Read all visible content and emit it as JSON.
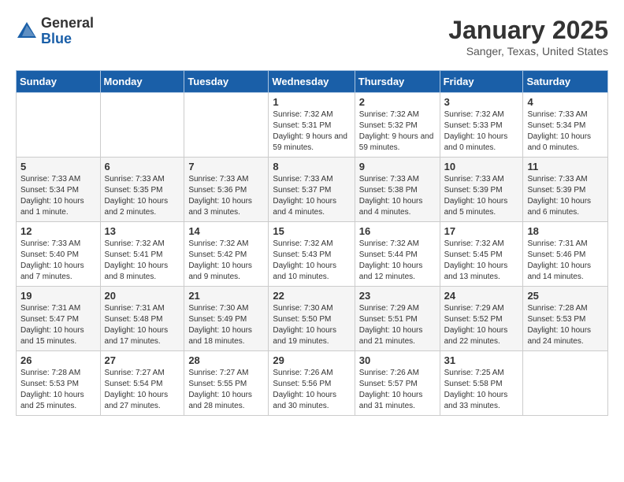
{
  "header": {
    "logo_general": "General",
    "logo_blue": "Blue",
    "title": "January 2025",
    "subtitle": "Sanger, Texas, United States"
  },
  "days_of_week": [
    "Sunday",
    "Monday",
    "Tuesday",
    "Wednesday",
    "Thursday",
    "Friday",
    "Saturday"
  ],
  "weeks": [
    [
      {
        "day": "",
        "info": ""
      },
      {
        "day": "",
        "info": ""
      },
      {
        "day": "",
        "info": ""
      },
      {
        "day": "1",
        "info": "Sunrise: 7:32 AM\nSunset: 5:31 PM\nDaylight: 9 hours and 59 minutes."
      },
      {
        "day": "2",
        "info": "Sunrise: 7:32 AM\nSunset: 5:32 PM\nDaylight: 9 hours and 59 minutes."
      },
      {
        "day": "3",
        "info": "Sunrise: 7:32 AM\nSunset: 5:33 PM\nDaylight: 10 hours and 0 minutes."
      },
      {
        "day": "4",
        "info": "Sunrise: 7:33 AM\nSunset: 5:34 PM\nDaylight: 10 hours and 0 minutes."
      }
    ],
    [
      {
        "day": "5",
        "info": "Sunrise: 7:33 AM\nSunset: 5:34 PM\nDaylight: 10 hours and 1 minute."
      },
      {
        "day": "6",
        "info": "Sunrise: 7:33 AM\nSunset: 5:35 PM\nDaylight: 10 hours and 2 minutes."
      },
      {
        "day": "7",
        "info": "Sunrise: 7:33 AM\nSunset: 5:36 PM\nDaylight: 10 hours and 3 minutes."
      },
      {
        "day": "8",
        "info": "Sunrise: 7:33 AM\nSunset: 5:37 PM\nDaylight: 10 hours and 4 minutes."
      },
      {
        "day": "9",
        "info": "Sunrise: 7:33 AM\nSunset: 5:38 PM\nDaylight: 10 hours and 4 minutes."
      },
      {
        "day": "10",
        "info": "Sunrise: 7:33 AM\nSunset: 5:39 PM\nDaylight: 10 hours and 5 minutes."
      },
      {
        "day": "11",
        "info": "Sunrise: 7:33 AM\nSunset: 5:39 PM\nDaylight: 10 hours and 6 minutes."
      }
    ],
    [
      {
        "day": "12",
        "info": "Sunrise: 7:33 AM\nSunset: 5:40 PM\nDaylight: 10 hours and 7 minutes."
      },
      {
        "day": "13",
        "info": "Sunrise: 7:32 AM\nSunset: 5:41 PM\nDaylight: 10 hours and 8 minutes."
      },
      {
        "day": "14",
        "info": "Sunrise: 7:32 AM\nSunset: 5:42 PM\nDaylight: 10 hours and 9 minutes."
      },
      {
        "day": "15",
        "info": "Sunrise: 7:32 AM\nSunset: 5:43 PM\nDaylight: 10 hours and 10 minutes."
      },
      {
        "day": "16",
        "info": "Sunrise: 7:32 AM\nSunset: 5:44 PM\nDaylight: 10 hours and 12 minutes."
      },
      {
        "day": "17",
        "info": "Sunrise: 7:32 AM\nSunset: 5:45 PM\nDaylight: 10 hours and 13 minutes."
      },
      {
        "day": "18",
        "info": "Sunrise: 7:31 AM\nSunset: 5:46 PM\nDaylight: 10 hours and 14 minutes."
      }
    ],
    [
      {
        "day": "19",
        "info": "Sunrise: 7:31 AM\nSunset: 5:47 PM\nDaylight: 10 hours and 15 minutes."
      },
      {
        "day": "20",
        "info": "Sunrise: 7:31 AM\nSunset: 5:48 PM\nDaylight: 10 hours and 17 minutes."
      },
      {
        "day": "21",
        "info": "Sunrise: 7:30 AM\nSunset: 5:49 PM\nDaylight: 10 hours and 18 minutes."
      },
      {
        "day": "22",
        "info": "Sunrise: 7:30 AM\nSunset: 5:50 PM\nDaylight: 10 hours and 19 minutes."
      },
      {
        "day": "23",
        "info": "Sunrise: 7:29 AM\nSunset: 5:51 PM\nDaylight: 10 hours and 21 minutes."
      },
      {
        "day": "24",
        "info": "Sunrise: 7:29 AM\nSunset: 5:52 PM\nDaylight: 10 hours and 22 minutes."
      },
      {
        "day": "25",
        "info": "Sunrise: 7:28 AM\nSunset: 5:53 PM\nDaylight: 10 hours and 24 minutes."
      }
    ],
    [
      {
        "day": "26",
        "info": "Sunrise: 7:28 AM\nSunset: 5:53 PM\nDaylight: 10 hours and 25 minutes."
      },
      {
        "day": "27",
        "info": "Sunrise: 7:27 AM\nSunset: 5:54 PM\nDaylight: 10 hours and 27 minutes."
      },
      {
        "day": "28",
        "info": "Sunrise: 7:27 AM\nSunset: 5:55 PM\nDaylight: 10 hours and 28 minutes."
      },
      {
        "day": "29",
        "info": "Sunrise: 7:26 AM\nSunset: 5:56 PM\nDaylight: 10 hours and 30 minutes."
      },
      {
        "day": "30",
        "info": "Sunrise: 7:26 AM\nSunset: 5:57 PM\nDaylight: 10 hours and 31 minutes."
      },
      {
        "day": "31",
        "info": "Sunrise: 7:25 AM\nSunset: 5:58 PM\nDaylight: 10 hours and 33 minutes."
      },
      {
        "day": "",
        "info": ""
      }
    ]
  ]
}
